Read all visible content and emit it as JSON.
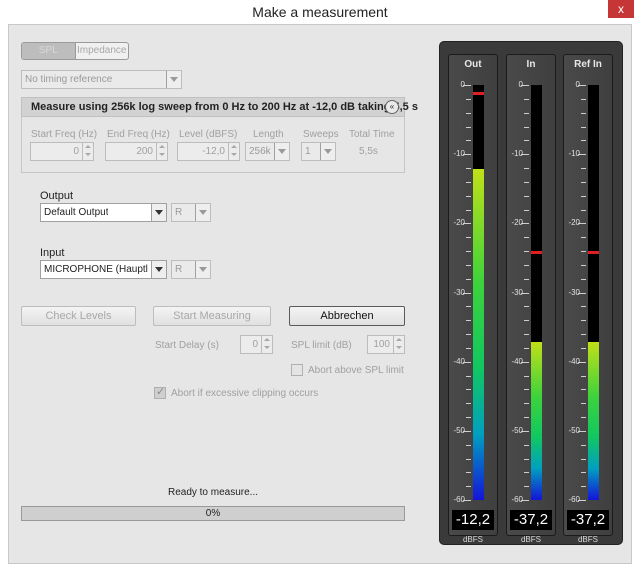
{
  "window": {
    "title": "Make a measurement",
    "close_glyph": "x"
  },
  "mode_toggle": {
    "options": [
      "SPL",
      "Impedance"
    ],
    "selected": "SPL"
  },
  "timing_reference": {
    "value": "No timing reference"
  },
  "sweep_panel": {
    "title": "Measure using 256k log sweep from 0 Hz to 200 Hz at -12,0 dB taking 5,5 s",
    "collapse_glyph": "«",
    "fields": {
      "start_freq": {
        "label": "Start Freq (Hz)",
        "value": "0"
      },
      "end_freq": {
        "label": "End Freq (Hz)",
        "value": "200"
      },
      "level": {
        "label": "Level (dBFS)",
        "value": "-12,0"
      },
      "length": {
        "label": "Length",
        "value": "256k"
      },
      "sweeps": {
        "label": "Sweeps",
        "value": "1"
      },
      "total_time": {
        "label": "Total Time",
        "value": "5,5s"
      }
    }
  },
  "output": {
    "label": "Output",
    "device": "Default Output",
    "channel": "R"
  },
  "input": {
    "label": "Input",
    "device": "MICROPHONE (Hauptlau...",
    "channel": "R"
  },
  "buttons": {
    "check_levels": "Check Levels",
    "start_measuring": "Start Measuring",
    "cancel": "Abbrechen"
  },
  "start_delay": {
    "label": "Start Delay (s)",
    "value": "0"
  },
  "spl_limit": {
    "label": "SPL limit (dB)",
    "value": "100"
  },
  "abort_above_spl": {
    "label": "Abort above SPL limit",
    "checked": false
  },
  "abort_clipping": {
    "label": "Abort if excessive clipping occurs",
    "checked": true
  },
  "status": {
    "text": "Ready to measure...",
    "progress_label": "0%",
    "progress_fraction": 0
  },
  "meters": {
    "scale": {
      "labels": [
        "0",
        "-10",
        "-20",
        "-30",
        "-40",
        "-50",
        "-60"
      ],
      "min": -60,
      "max": 0
    },
    "unit": "dBFS",
    "channels": [
      {
        "name": "Out",
        "readout": "-12,2",
        "level": -12.2,
        "peak": -1
      },
      {
        "name": "In",
        "readout": "-37,2",
        "level": -37.2,
        "peak": -24
      },
      {
        "name": "Ref In",
        "readout": "-37,2",
        "level": -37.2,
        "peak": -24
      }
    ]
  }
}
